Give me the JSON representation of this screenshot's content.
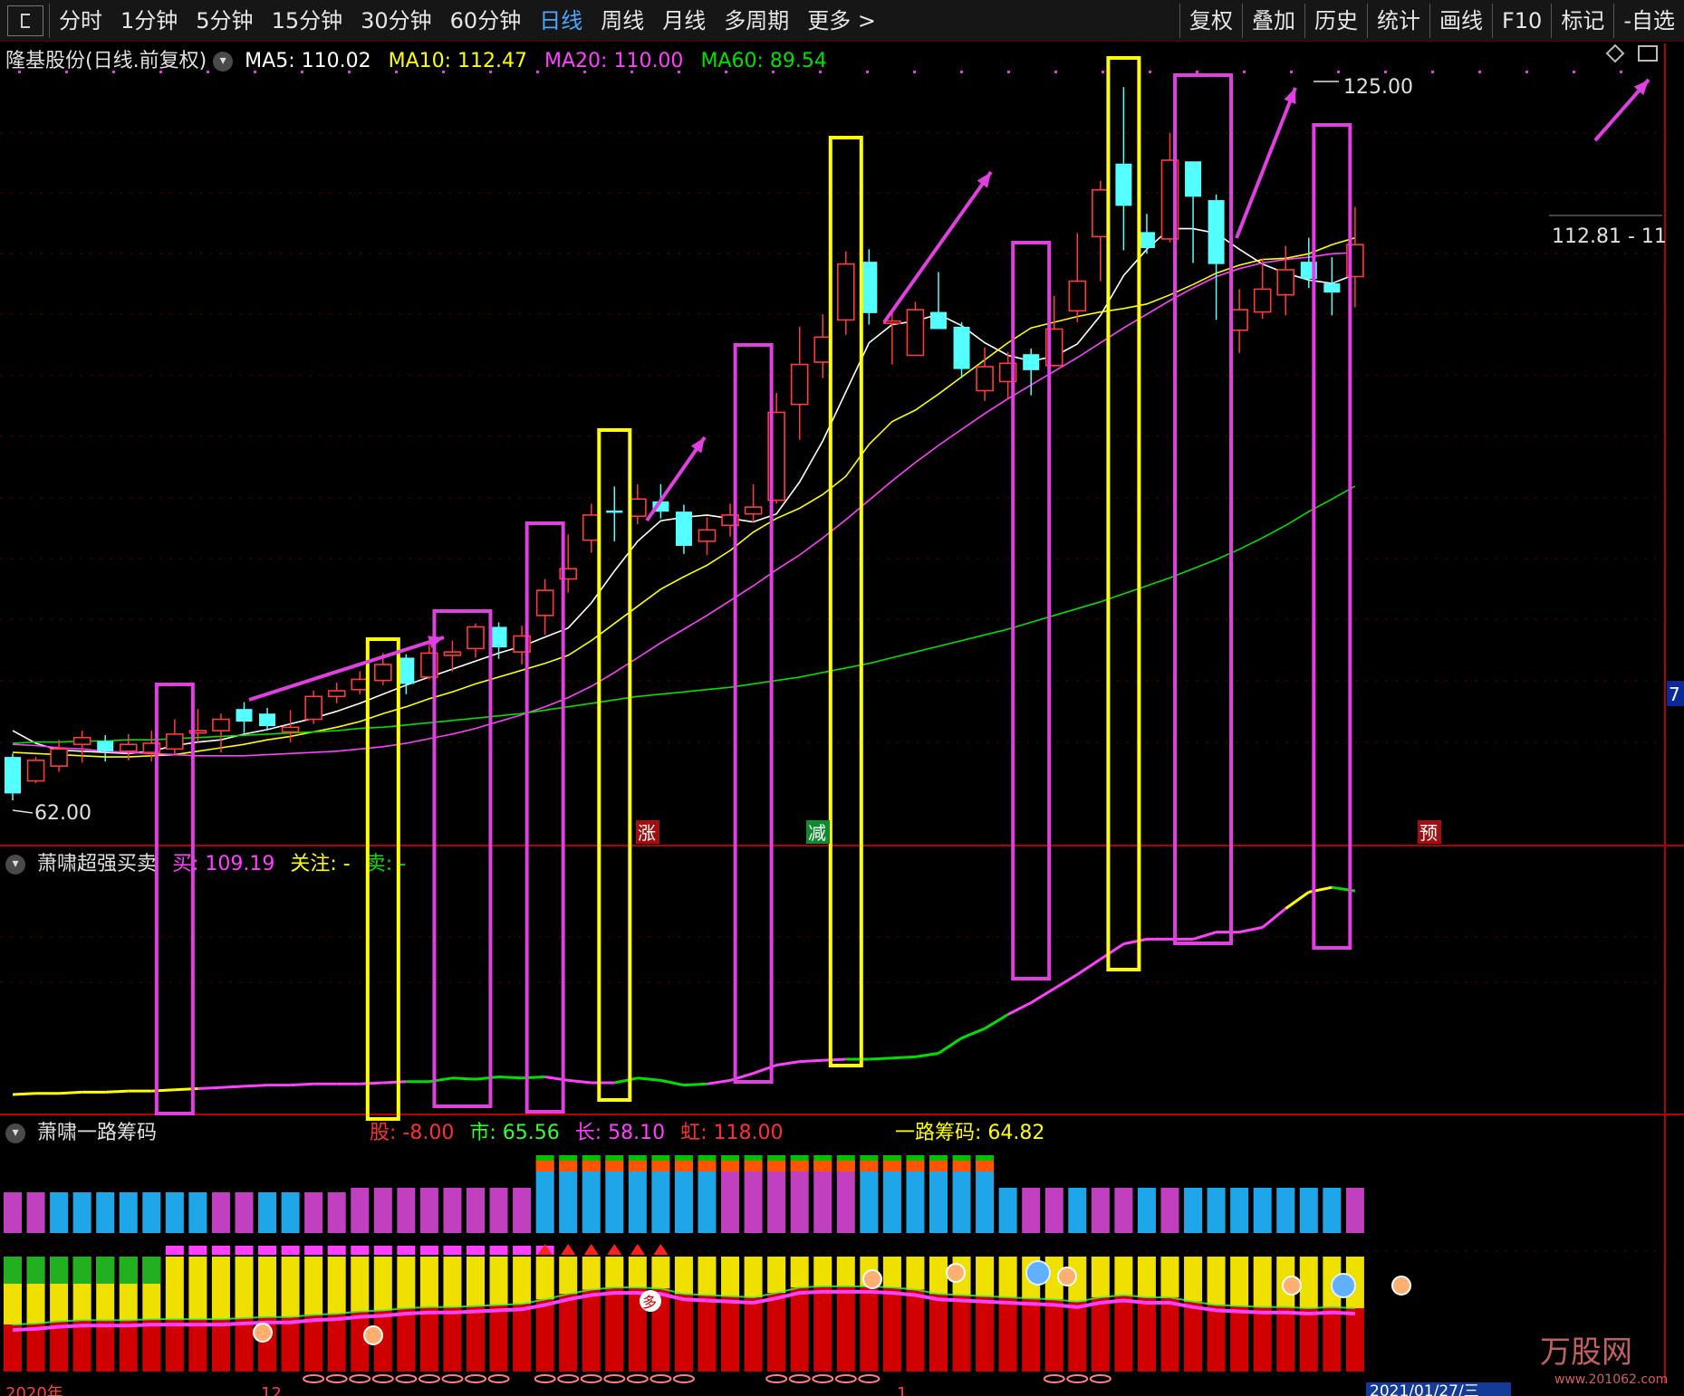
{
  "toolbar": {
    "periods": [
      "分时",
      "1分钟",
      "5分钟",
      "15分钟",
      "30分钟",
      "60分钟",
      "日线",
      "周线",
      "月线",
      "多周期",
      "更多 >"
    ],
    "active": "日线",
    "right": [
      "复权",
      "叠加",
      "历史",
      "统计",
      "画线",
      "F10",
      "标记",
      "-自选"
    ]
  },
  "main_panel": {
    "title": "隆基股份(日线.前复权)",
    "ma5_label": "MA5: 110.02",
    "ma10_label": "MA10: 112.47",
    "ma20_label": "MA20: 110.00",
    "ma60_label": "MA60: 89.54",
    "high_label": "125.00",
    "low_label": "62.00",
    "last_label": "112.81 - 11",
    "side_label": "7",
    "markers": [
      "涨",
      "减",
      "预"
    ]
  },
  "sub1": {
    "title": "萧啸超强买卖",
    "buy_label": "买: 109.19",
    "watch_label": "关注: -",
    "sell_label": "卖: -"
  },
  "sub2": {
    "title": "萧啸一路筹码",
    "gu_label": "股: -8.00",
    "shi_label": "市: 65.56",
    "chang_label": "长: 58.10",
    "hong_label": "虹: 118.00",
    "ylcm_label": "一路筹码: 64.82",
    "duo_marker": "多"
  },
  "footer": {
    "left_date": "2020年",
    "mid1": "12",
    "mid2": "1",
    "right_date": "2021/01/27/三"
  },
  "watermark": {
    "brand": "万股网",
    "site": "www.201062.com"
  },
  "colors": {
    "up": "#ff3b3b",
    "down": "#54ffff",
    "ma5": "#ffffff",
    "ma10": "#ffff00",
    "ma20": "#ff40ff",
    "ma60": "#00e000",
    "box_magenta": "#e040e0",
    "box_yellow": "#ffff00"
  },
  "chart_data": [
    {
      "type": "candlestick",
      "series_name": "隆基股份",
      "ylim": [
        62.0,
        125.0
      ],
      "series": [
        {
          "name": "K",
          "ohlc": [
            [
              65.8,
              62.6,
              66.1,
              62.0
            ],
            [
              63.7,
              65.5,
              65.8,
              63.5
            ],
            [
              65.0,
              66.5,
              67.3,
              64.5
            ],
            [
              66.9,
              67.5,
              68.1,
              65.3
            ],
            [
              67.2,
              66.3,
              67.7,
              65.4
            ],
            [
              66.3,
              66.9,
              67.8,
              65.5
            ],
            [
              66.2,
              67.0,
              68.1,
              65.4
            ],
            [
              66.5,
              67.8,
              69.1,
              66.0
            ],
            [
              67.9,
              68.1,
              70.0,
              67.1
            ],
            [
              68.1,
              69.1,
              69.6,
              66.2
            ],
            [
              70.0,
              68.9,
              70.6,
              67.9
            ],
            [
              69.6,
              68.5,
              70.1,
              68.1
            ],
            [
              68.0,
              68.4,
              69.9,
              67.1
            ],
            [
              69.1,
              71.1,
              71.6,
              68.7
            ],
            [
              71.1,
              71.6,
              72.3,
              70.5
            ],
            [
              71.7,
              72.6,
              73.3,
              71.3
            ],
            [
              72.5,
              73.9,
              74.9,
              72.1
            ],
            [
              74.5,
              72.2,
              74.8,
              71.3
            ],
            [
              72.8,
              74.9,
              75.9,
              72.6
            ],
            [
              74.7,
              75.0,
              76.0,
              73.3
            ],
            [
              75.3,
              77.2,
              77.5,
              74.5
            ],
            [
              77.2,
              75.4,
              77.6,
              74.4
            ],
            [
              75.0,
              76.4,
              77.3,
              73.9
            ],
            [
              78.2,
              80.4,
              81.4,
              76.5
            ],
            [
              81.4,
              82.3,
              85.3,
              80.2
            ],
            [
              84.8,
              87.0,
              88.0,
              83.7
            ],
            [
              87.4,
              87.2,
              89.5,
              84.7
            ],
            [
              86.9,
              88.4,
              89.7,
              86.2
            ],
            [
              88.2,
              87.3,
              89.7,
              86.7
            ],
            [
              87.3,
              84.3,
              87.9,
              83.6
            ],
            [
              84.7,
              85.7,
              86.8,
              83.5
            ],
            [
              86.1,
              87.0,
              88.0,
              85.1
            ],
            [
              87.1,
              87.7,
              89.7,
              86.3
            ],
            [
              88.3,
              96.0,
              97.7,
              88.0
            ],
            [
              96.7,
              100.2,
              103.5,
              93.6
            ],
            [
              100.4,
              102.6,
              104.6,
              99.0
            ],
            [
              104.1,
              109.0,
              110.1,
              102.8
            ],
            [
              109.2,
              104.7,
              110.3,
              103.7
            ],
            [
              103.8,
              104.0,
              105.1,
              100.2
            ],
            [
              101.0,
              105.0,
              105.7,
              101.5
            ],
            [
              104.8,
              103.3,
              108.3,
              103.4
            ],
            [
              103.5,
              99.8,
              103.9,
              99.0
            ],
            [
              97.9,
              100.0,
              101.7,
              97.0
            ],
            [
              98.7,
              100.3,
              101.3,
              97.2
            ],
            [
              101.1,
              99.7,
              101.6,
              97.5
            ],
            [
              100.1,
              103.3,
              106.2,
              100.0
            ],
            [
              104.9,
              107.5,
              111.7,
              103.9
            ],
            [
              111.4,
              115.5,
              116.3,
              107.5
            ],
            [
              117.8,
              114.1,
              124.5,
              110.2
            ],
            [
              111.8,
              110.4,
              113.4,
              109.9
            ],
            [
              111.2,
              118.1,
              120.5,
              110.9
            ],
            [
              118.0,
              114.9,
              117.1,
              109.1
            ],
            [
              114.6,
              109.0,
              115.1,
              104.1
            ],
            [
              103.2,
              105.0,
              106.8,
              101.2
            ],
            [
              104.8,
              106.8,
              109.5,
              104.2
            ],
            [
              106.3,
              108.5,
              110.6,
              104.5
            ],
            [
              109.2,
              107.7,
              111.3,
              106.9
            ],
            [
              107.3,
              106.5,
              109.6,
              104.5
            ],
            [
              107.9,
              110.7,
              114.0,
              105.2
            ]
          ]
        },
        {
          "name": "MA5",
          "values": [
            68.1,
            67.0,
            66.4,
            66.3,
            66.2,
            66.1,
            66.3,
            66.8,
            67.1,
            67.3,
            67.8,
            68.2,
            68.7,
            69.2,
            69.8,
            70.5,
            71.3,
            72.1,
            72.8,
            73.5,
            74.2,
            74.9,
            75.5,
            76.3,
            77.1,
            79.3,
            82.1,
            84.7,
            86.5,
            86.8,
            87.0,
            86.7,
            86.4,
            87.1,
            89.9,
            93.5,
            97.8,
            102.1,
            103.7,
            104.0,
            104.6,
            103.6,
            102.1,
            101.0,
            100.5,
            100.9,
            102.0,
            104.5,
            108.0,
            110.3,
            112.1,
            112.1,
            111.7,
            110.3,
            109.0,
            108.2,
            107.6,
            107.3,
            108.1
          ]
        },
        {
          "name": "MA10",
          "values": [
            66.2,
            66.1,
            66.0,
            65.9,
            65.8,
            65.8,
            65.9,
            66.0,
            66.3,
            66.6,
            66.9,
            67.3,
            67.6,
            68.0,
            68.4,
            68.9,
            69.6,
            70.2,
            70.9,
            71.5,
            72.2,
            72.8,
            73.4,
            74.0,
            74.7,
            76.0,
            77.5,
            79.0,
            80.5,
            81.6,
            82.6,
            83.9,
            85.5,
            86.7,
            87.6,
            88.8,
            90.4,
            93.2,
            95.2,
            96.2,
            97.6,
            99.1,
            100.6,
            102.1,
            103.4,
            103.9,
            104.4,
            104.8,
            105.1,
            105.5,
            106.3,
            107.2,
            108.2,
            108.9,
            109.4,
            109.5,
            109.9,
            110.7,
            111.3
          ]
        },
        {
          "name": "MA20",
          "values": [
            66.9,
            66.8,
            66.6,
            66.5,
            66.3,
            66.2,
            66.1,
            66.0,
            65.9,
            65.9,
            65.9,
            66.0,
            66.1,
            66.2,
            66.3,
            66.5,
            66.7,
            67.0,
            67.4,
            67.8,
            68.3,
            68.9,
            69.5,
            70.2,
            71.0,
            72.0,
            73.2,
            74.5,
            75.8,
            77.0,
            78.2,
            79.5,
            80.8,
            82.2,
            83.5,
            85.0,
            86.6,
            88.3,
            90.0,
            91.6,
            93.1,
            94.5,
            95.9,
            97.2,
            98.4,
            99.6,
            100.8,
            102.1,
            103.4,
            104.6,
            105.8,
            106.9,
            107.9,
            108.6,
            109.1,
            109.4,
            109.6,
            109.9,
            110.0
          ]
        },
        {
          "name": "MA60",
          "values": [
            67.0,
            67.1,
            67.1,
            67.2,
            67.2,
            67.3,
            67.3,
            67.4,
            67.5,
            67.6,
            67.7,
            67.8,
            67.9,
            68.0,
            68.1,
            68.3,
            68.4,
            68.6,
            68.8,
            69.0,
            69.2,
            69.4,
            69.6,
            69.9,
            70.2,
            70.5,
            70.8,
            71.1,
            71.3,
            71.5,
            71.7,
            71.9,
            72.2,
            72.5,
            72.8,
            73.2,
            73.6,
            74.0,
            74.5,
            75.0,
            75.5,
            76.0,
            76.5,
            77.0,
            77.6,
            78.2,
            78.8,
            79.4,
            80.1,
            80.8,
            81.5,
            82.3,
            83.1,
            84.0,
            85.0,
            86.1,
            87.3,
            88.4,
            89.54
          ]
        }
      ]
    },
    {
      "type": "line",
      "series": [
        {
          "name": "买",
          "values": [
            10,
            11,
            11,
            12,
            12,
            13,
            13,
            14,
            15,
            16,
            17,
            18,
            18,
            19,
            19,
            19,
            20,
            21,
            21,
            24,
            23,
            25,
            24,
            25,
            22,
            20,
            20,
            24,
            22,
            18,
            19,
            22,
            28,
            35,
            38,
            39,
            40,
            40,
            41,
            42,
            45,
            58,
            66,
            78,
            88,
            100,
            112,
            125,
            138,
            142,
            142,
            142,
            148,
            148,
            152,
            168,
            182,
            186,
            183
          ]
        }
      ]
    },
    {
      "type": "bar",
      "series": [
        {
          "name": "筹码",
          "values": [
            0.43,
            0.44,
            0.46,
            0.47,
            0.47,
            0.47,
            0.48,
            0.48,
            0.48,
            0.48,
            0.49,
            0.5,
            0.5,
            0.52,
            0.53,
            0.55,
            0.56,
            0.58,
            0.59,
            0.59,
            0.6,
            0.61,
            0.62,
            0.66,
            0.71,
            0.75,
            0.77,
            0.77,
            0.76,
            0.71,
            0.7,
            0.69,
            0.68,
            0.72,
            0.77,
            0.78,
            0.78,
            0.78,
            0.77,
            0.75,
            0.71,
            0.7,
            0.69,
            0.68,
            0.67,
            0.66,
            0.64,
            0.68,
            0.7,
            0.68,
            0.68,
            0.64,
            0.61,
            0.6,
            0.59,
            0.59,
            0.58,
            0.59,
            0.58
          ]
        }
      ]
    }
  ]
}
